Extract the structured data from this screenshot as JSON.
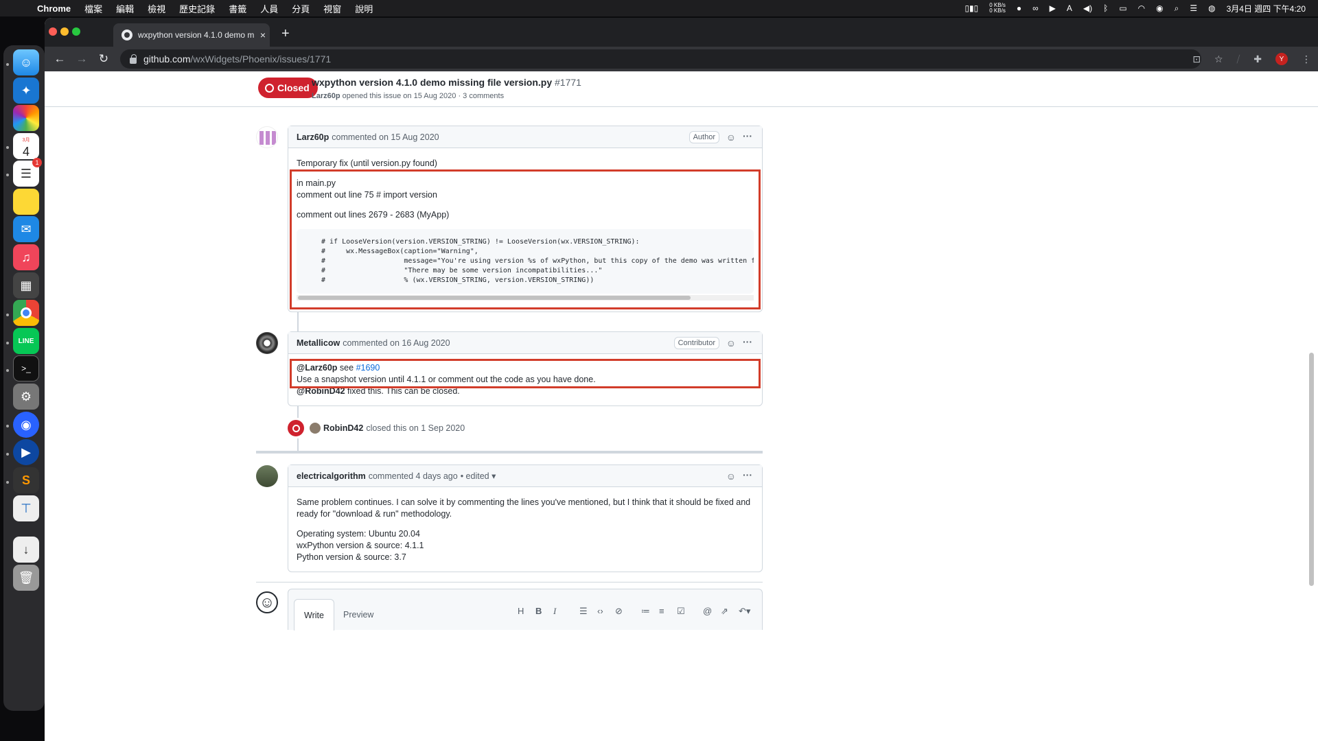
{
  "menubar": {
    "app": "Chrome",
    "items": [
      "檔案",
      "編輯",
      "檢視",
      "歷史記錄",
      "書籤",
      "人員",
      "分頁",
      "視窗",
      "說明"
    ],
    "net_up": "0 KB/s",
    "net_down": "0 KB/s",
    "datetime": "3月4日 週四 下午4:20"
  },
  "dock": {
    "calendar_month": "3月",
    "calendar_day": "4",
    "reminders_badge": "1"
  },
  "browser": {
    "tab_title": "wxpython version 4.1.0 demo m",
    "url_host": "github.com",
    "url_path": "/wxWidgets/Phoenix/issues/1771",
    "profile_initial": "Y"
  },
  "issue": {
    "state": "Closed",
    "title": "wxpython version 4.1.0 demo missing file version.py",
    "number": "#1771",
    "opener": "Larz60p",
    "meta_rest": "opened this issue on 15 Aug 2020 · 3 comments"
  },
  "comments": [
    {
      "author": "Larz60p",
      "meta": "commented on 15 Aug 2020",
      "role": "Author",
      "intro": "Temporary fix (until version.py found)",
      "line1": "in main.py",
      "line2": "comment out line 75 # import version",
      "line3": "comment out lines 2679 - 2683 (MyApp)",
      "code": "# if LooseVersion(version.VERSION_STRING) != LooseVersion(wx.VERSION_STRING):\n#     wx.MessageBox(caption=\"Warning\",\n#                   message=\"You're using version %s of wxPython, but this copy of the demo was written for\n#                   \"There may be some version incompatibilities...\"\n#                   % (wx.VERSION_STRING, version.VERSION_STRING))"
    },
    {
      "author": "Metallicow",
      "meta": "commented on 16 Aug 2020",
      "role": "Contributor",
      "mention1": "@Larz60p",
      "see": "see",
      "ref": "#1690",
      "line2": "Use a snapshot version until 4.1.1 or comment out the code as you have done.",
      "mention2": "@RobinD42",
      "line3": "fixed this. This can be closed."
    },
    {
      "author": "electricalgorithm",
      "meta": "commented 4 days ago",
      "edited": "• edited",
      "para1": "Same problem continues. I can solve it by commenting the lines you've mentioned, but I think that it should be fixed and ready for \"download & run\" methodology.",
      "os": "Operating system: Ubuntu 20.04",
      "wx": "wxPython version & source: 4.1.1",
      "py": "Python version & source: 3.7"
    }
  ],
  "event": {
    "actor": "RobinD42",
    "text": "closed this on 1 Sep 2020"
  },
  "editor": {
    "write_tab": "Write",
    "preview_tab": "Preview",
    "toolbar": [
      "H",
      "B",
      "I",
      "quote",
      "code",
      "link",
      "ul",
      "ol",
      "task",
      "@",
      "ref",
      "reply"
    ]
  },
  "colors": {
    "closed_red": "#cf222e",
    "link_blue": "#0969da",
    "annotation_red": "#d23c2a"
  }
}
